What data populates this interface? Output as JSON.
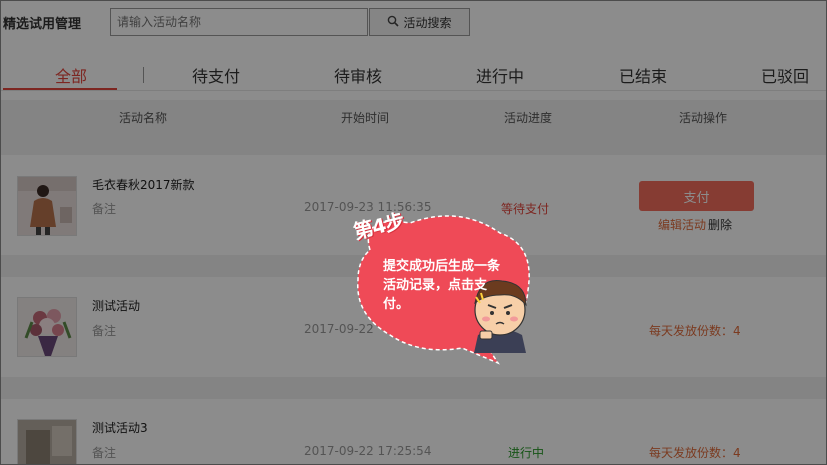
{
  "header": {
    "title": "精选试用管理",
    "search_placeholder": "请输入活动名称",
    "search_button": "活动搜索"
  },
  "tabs": [
    {
      "label": "全部",
      "active": true
    },
    {
      "label": "待支付",
      "active": false
    },
    {
      "label": "待审核",
      "active": false
    },
    {
      "label": "进行中",
      "active": false
    },
    {
      "label": "已结束",
      "active": false
    },
    {
      "label": "已驳回",
      "active": false
    }
  ],
  "table": {
    "headers": [
      "活动名称",
      "开始时间",
      "活动进度",
      "活动操作"
    ]
  },
  "rows": [
    {
      "name": "毛衣春秋2017新款",
      "note": "备注",
      "time": "2017-09-23 11:56:35",
      "status": "等待支付",
      "pay_button": "支付",
      "edit_link": "编辑活动",
      "delete_link": "删除"
    },
    {
      "name": "测试活动",
      "note": "备注",
      "time": "2017-09-22",
      "quota": "每天发放份数：4"
    },
    {
      "name": "测试活动3",
      "note": "备注",
      "time": "2017-09-22 17:25:54",
      "status": "进行中",
      "quota": "每天发放份数：4"
    }
  ],
  "guide": {
    "step": "第4步",
    "text": "提交成功后生成一条活动记录，点击支付。"
  },
  "colors": {
    "accent": "#e4463d",
    "pay_button": "#f56e5d",
    "bubble": "#ef4a57",
    "in_progress": "#2a9a2a",
    "link_orange": "#e06c3c"
  }
}
